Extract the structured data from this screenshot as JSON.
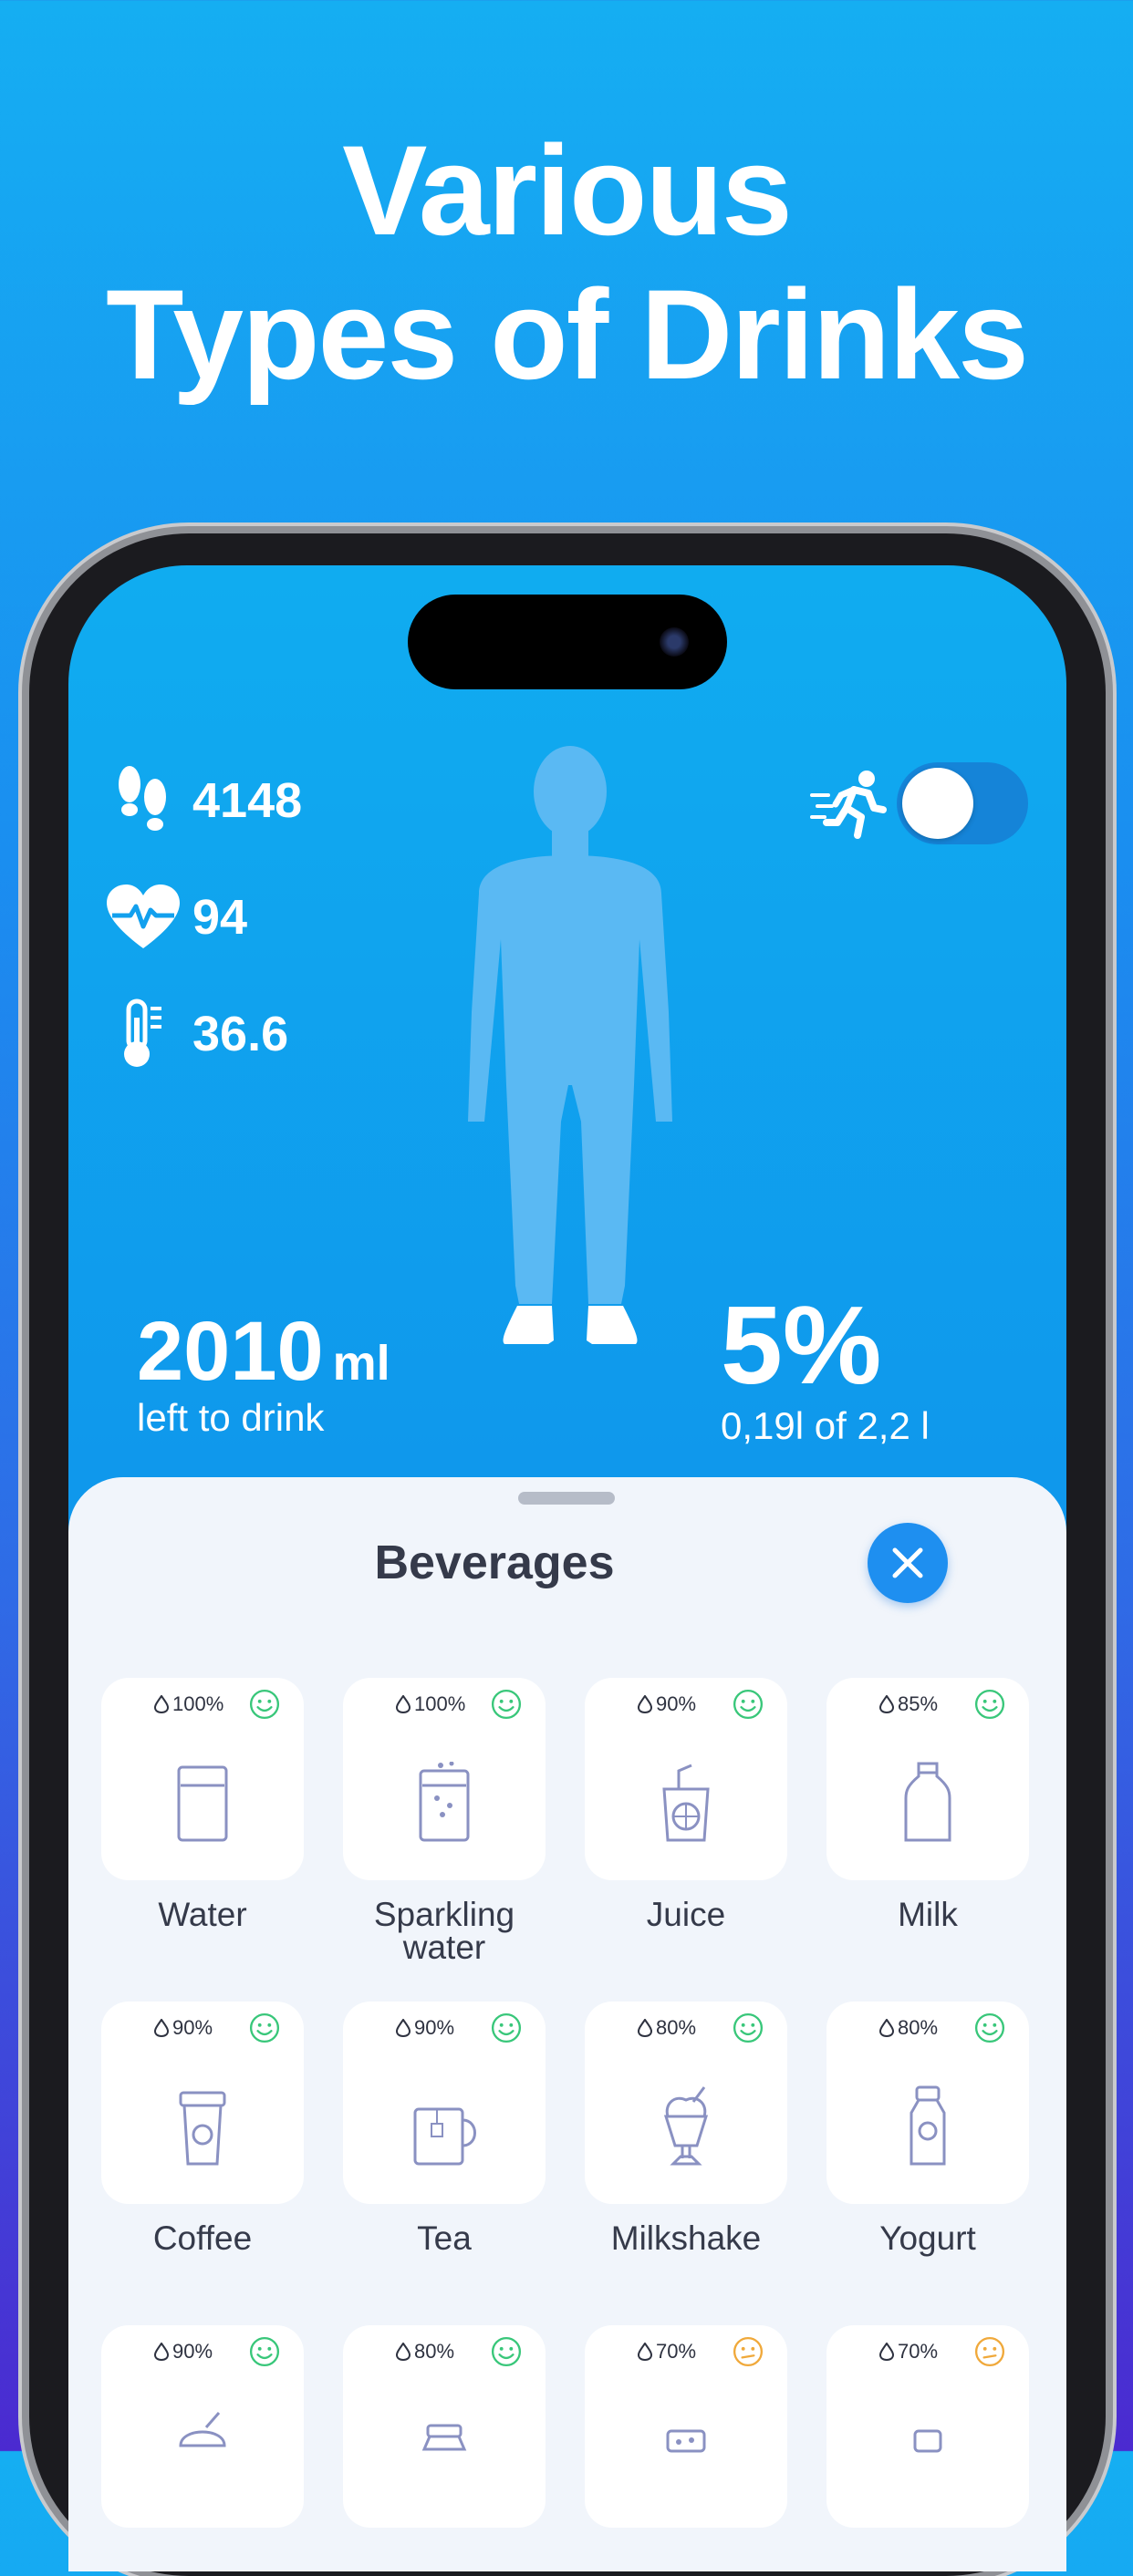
{
  "headline": {
    "line1": "Various",
    "line2": "Types of Drinks"
  },
  "stats": [
    {
      "icon": "footprints-icon",
      "value": "4148"
    },
    {
      "icon": "heart-pulse-icon",
      "value": "94"
    },
    {
      "icon": "thermometer-icon",
      "value": "36.6"
    }
  ],
  "activity_toggle": {
    "icon": "running-person-icon",
    "on": false
  },
  "left": {
    "amount": "2010",
    "unit": "ml",
    "label": "left to drink"
  },
  "progress": {
    "percent": "5%",
    "detail": "0,19l of 2,2 l",
    "fraction": 0.05
  },
  "sheet": {
    "title": "Beverages"
  },
  "beverages": [
    {
      "name": "Water",
      "percent": "100%",
      "mood": "happy"
    },
    {
      "name": "Sparkling water",
      "percent": "100%",
      "mood": "happy"
    },
    {
      "name": "Juice",
      "percent": "90%",
      "mood": "happy"
    },
    {
      "name": "Milk",
      "percent": "85%",
      "mood": "happy"
    },
    {
      "name": "Coffee",
      "percent": "90%",
      "mood": "happy"
    },
    {
      "name": "Tea",
      "percent": "90%",
      "mood": "happy"
    },
    {
      "name": "Milkshake",
      "percent": "80%",
      "mood": "happy"
    },
    {
      "name": "Yogurt",
      "percent": "80%",
      "mood": "happy"
    },
    {
      "name": "",
      "percent": "90%",
      "mood": "happy"
    },
    {
      "name": "",
      "percent": "80%",
      "mood": "happy"
    },
    {
      "name": "",
      "percent": "70%",
      "mood": "neutral"
    },
    {
      "name": "",
      "percent": "70%",
      "mood": "neutral"
    }
  ],
  "colors": {
    "happy": "#39c77a",
    "neutral": "#f0a93b",
    "accent": "#1e8ff0"
  }
}
